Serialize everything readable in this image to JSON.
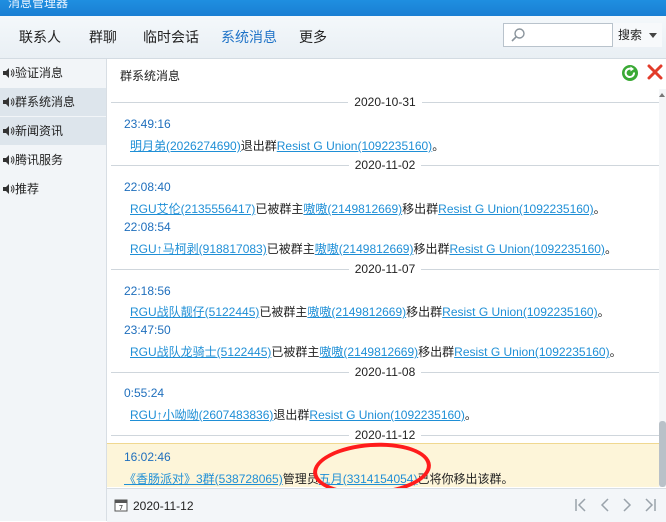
{
  "window": {
    "title": "消息管理器"
  },
  "nav": {
    "tabs": [
      {
        "label": "联系人"
      },
      {
        "label": "群聊"
      },
      {
        "label": "临时会话"
      },
      {
        "label": "系统消息",
        "active": true
      },
      {
        "label": "更多"
      }
    ],
    "search": {
      "value": "",
      "button_label": "搜索"
    }
  },
  "sidebar": {
    "items": [
      {
        "label": "验证消息",
        "icon": "speaker-icon"
      },
      {
        "label": "群系统消息",
        "icon": "speaker-icon",
        "selected": true
      },
      {
        "label": "新闻资讯",
        "icon": "speaker-icon"
      },
      {
        "label": "腾讯服务",
        "icon": "speaker-icon"
      },
      {
        "label": "推荐",
        "icon": "speaker-icon"
      }
    ]
  },
  "main": {
    "title": "群系统消息",
    "messages": {
      "d1": "2020-10-31",
      "m1": {
        "time": "23:49:16",
        "user": "明月弟(2026274690)",
        "t1": "退出群",
        "group": "Resist G Union(1092235160)",
        "end": "。"
      },
      "d2": "2020-11-02",
      "m2": {
        "time": "22:08:40",
        "user": "RGU艾伦(2135556417)",
        "t1": "已被群主",
        "owner": "嗷嗷(2149812669)",
        "t2": "移出群",
        "group": "Resist G Union(1092235160)",
        "end": "。"
      },
      "m3": {
        "time": "22:08:54",
        "user": "RGU↑马柯剥(918817083)",
        "t1": "已被群主",
        "owner": "嗷嗷(2149812669)",
        "t2": "移出群",
        "group": "Resist G Union(1092235160)",
        "end": "。"
      },
      "d3": "2020-11-07",
      "m4": {
        "time": "22:18:56",
        "user": "RGU战队靓仔(5122445)",
        "t1": "已被群主",
        "owner": "嗷嗷(2149812669)",
        "t2": "移出群",
        "group": "Resist G Union(1092235160)",
        "end": "。"
      },
      "m5": {
        "time": "23:47:50",
        "user": "RGU战队龙骑士(5122445)",
        "t1": "已被群主",
        "owner": "嗷嗷(2149812669)",
        "t2": "移出群",
        "group": "Resist G Union(1092235160)",
        "end": "。"
      },
      "d4": "2020-11-08",
      "m6": {
        "time": "0:55:24",
        "user": "RGU↑小呦呦(2607483836)",
        "t1": "退出群",
        "group": "Resist G Union(1092235160)",
        "end": "。"
      },
      "d5": "2020-11-12",
      "m7": {
        "time": "16:02:46",
        "group": "《香肠派对》3群(538728065)",
        "t1": "管理员",
        "admin": "五月(3314154054)",
        "t2": "已将你移出该群。"
      }
    }
  },
  "bottom": {
    "date": "2020-11-12"
  },
  "colors": {
    "link": "#1f8fd6",
    "time": "#1f6fbd",
    "highlight_bg": "#fdf5d9",
    "annotation": "#ff1c1c"
  }
}
